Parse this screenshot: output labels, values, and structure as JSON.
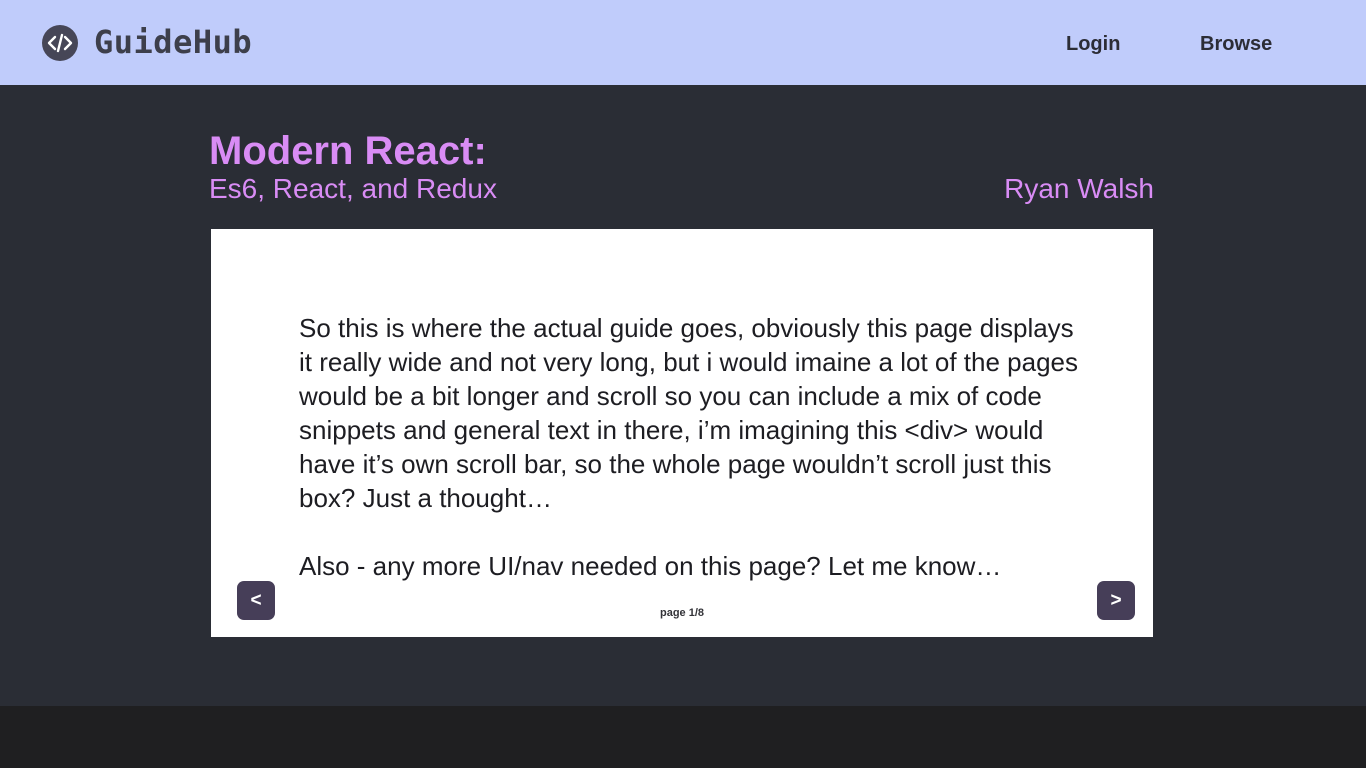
{
  "header": {
    "brand": "GuideHub",
    "logo_icon": "code-brackets-icon",
    "nav": {
      "login": "Login",
      "browse": "Browse"
    }
  },
  "guide": {
    "title": "Modern React:",
    "subtitle": "Es6, React, and Redux",
    "author": "Ryan Walsh",
    "paragraphs": [
      "So this is where the actual guide goes, obviously this page displays it really wide and not very long, but i would imaine a lot of the pages would be a bit longer and scroll so you can include a mix of code snippets and general text in there, i’m imagining this <div> would have it’s own scroll bar, so the whole page wouldn’t scroll just this box? Just a thought…",
      "Also - any more UI/nav needed on this page? Let me know…"
    ],
    "prev_label": "<",
    "next_label": ">",
    "page_indicator": "page 1/8"
  },
  "colors": {
    "header_bg": "#c0ccfb",
    "page_bg": "#2a2d35",
    "accent": "#d98cf5",
    "button_bg": "#463e58",
    "footer_bg": "#1f1f21"
  }
}
